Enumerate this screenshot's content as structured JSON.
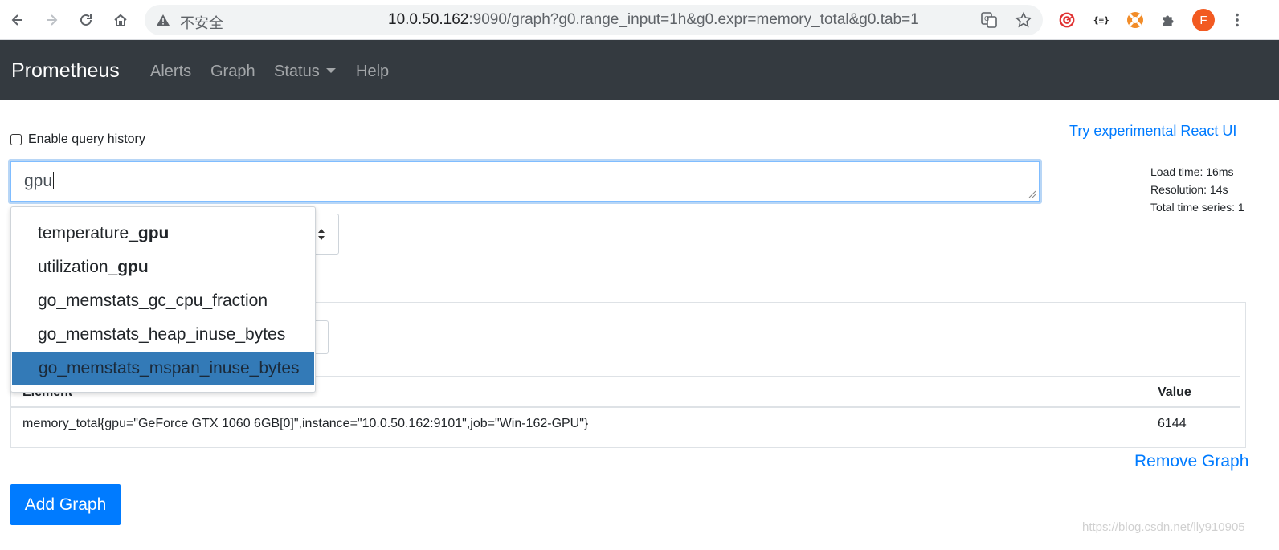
{
  "browser": {
    "insecure_label": "不安全",
    "url_host": "10.0.50.162",
    "url_rest": ":9090/graph?g0.range_input=1h&g0.expr=memory_total&g0.tab=1",
    "avatar_letter": "F"
  },
  "navbar": {
    "brand": "Prometheus",
    "links": [
      "Alerts",
      "Graph",
      "Status",
      "Help"
    ]
  },
  "options": {
    "history_label": "Enable query history",
    "react_link": "Try experimental React UI"
  },
  "query": {
    "value": "gpu"
  },
  "stats": {
    "load_time": "Load time: 16ms",
    "resolution": "Resolution: 14s",
    "total_series": "Total time series: 1"
  },
  "autocomplete": {
    "items": [
      {
        "prefix": "temperature_",
        "match": "gpu",
        "rest": ""
      },
      {
        "prefix": "utilization_",
        "match": "gpu",
        "rest": ""
      },
      {
        "prefix": "go_memstats_gc_cpu_fraction",
        "match": "",
        "rest": ""
      },
      {
        "prefix": "go_memstats_heap_inuse_bytes",
        "match": "",
        "rest": ""
      },
      {
        "prefix": "go_memstats_mspan_inuse_bytes",
        "match": "",
        "rest": ""
      }
    ],
    "selected_index": 4
  },
  "table": {
    "headers": {
      "element": "Element",
      "value": "Value"
    },
    "rows": [
      {
        "element": "memory_total{gpu=\"GeForce GTX 1060 6GB[0]\",instance=\"10.0.50.162:9101\",job=\"Win-162-GPU\"}",
        "value": "6144"
      }
    ]
  },
  "actions": {
    "remove_graph": "Remove Graph",
    "add_graph": "Add Graph"
  },
  "watermark": "https://blog.csdn.net/lly910905",
  "colors": {
    "navbar_bg": "#343a40",
    "link_blue": "#007bff",
    "dropdown_active": "#337ab7"
  }
}
